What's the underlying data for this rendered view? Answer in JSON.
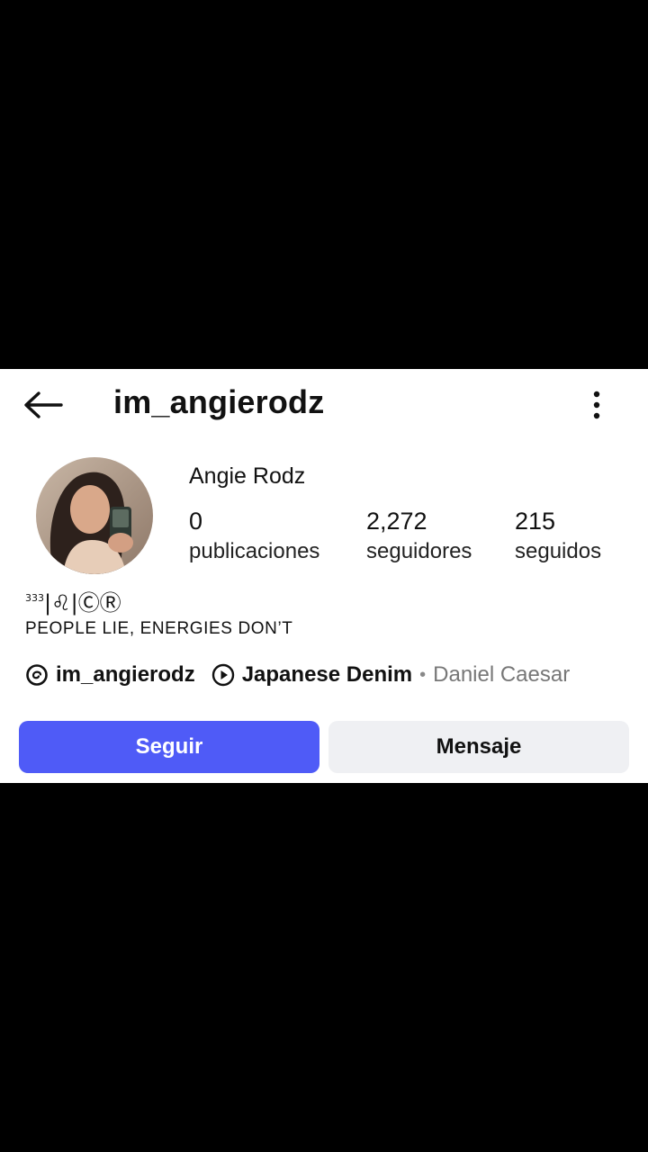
{
  "header": {
    "username": "im_angierodz"
  },
  "profile": {
    "display_name": "Angie Rodz",
    "stats": [
      {
        "count": "0",
        "label": "publicaciones"
      },
      {
        "count": "2,272",
        "label": "seguidores"
      },
      {
        "count": "215",
        "label": "seguidos"
      }
    ],
    "bio_line1_sup": "333",
    "bio_line1_rest": "|♌|ⒸⓇ",
    "bio_line2": "PEOPLE LIE, ENERGIES DON’T"
  },
  "links": {
    "threads_handle": "im_angierodz",
    "song": "Japanese Denim",
    "separator": "•",
    "artist": "Daniel Caesar"
  },
  "actions": {
    "follow_label": "Seguir",
    "message_label": "Mensaje"
  },
  "icons": {
    "back": "arrow-left-icon",
    "more": "more-vertical-icon",
    "threads": "threads-icon",
    "music": "play-circle-icon"
  },
  "colors": {
    "follow_button": "#4f5bf7",
    "message_button": "#eff0f3",
    "background": "#000000"
  }
}
